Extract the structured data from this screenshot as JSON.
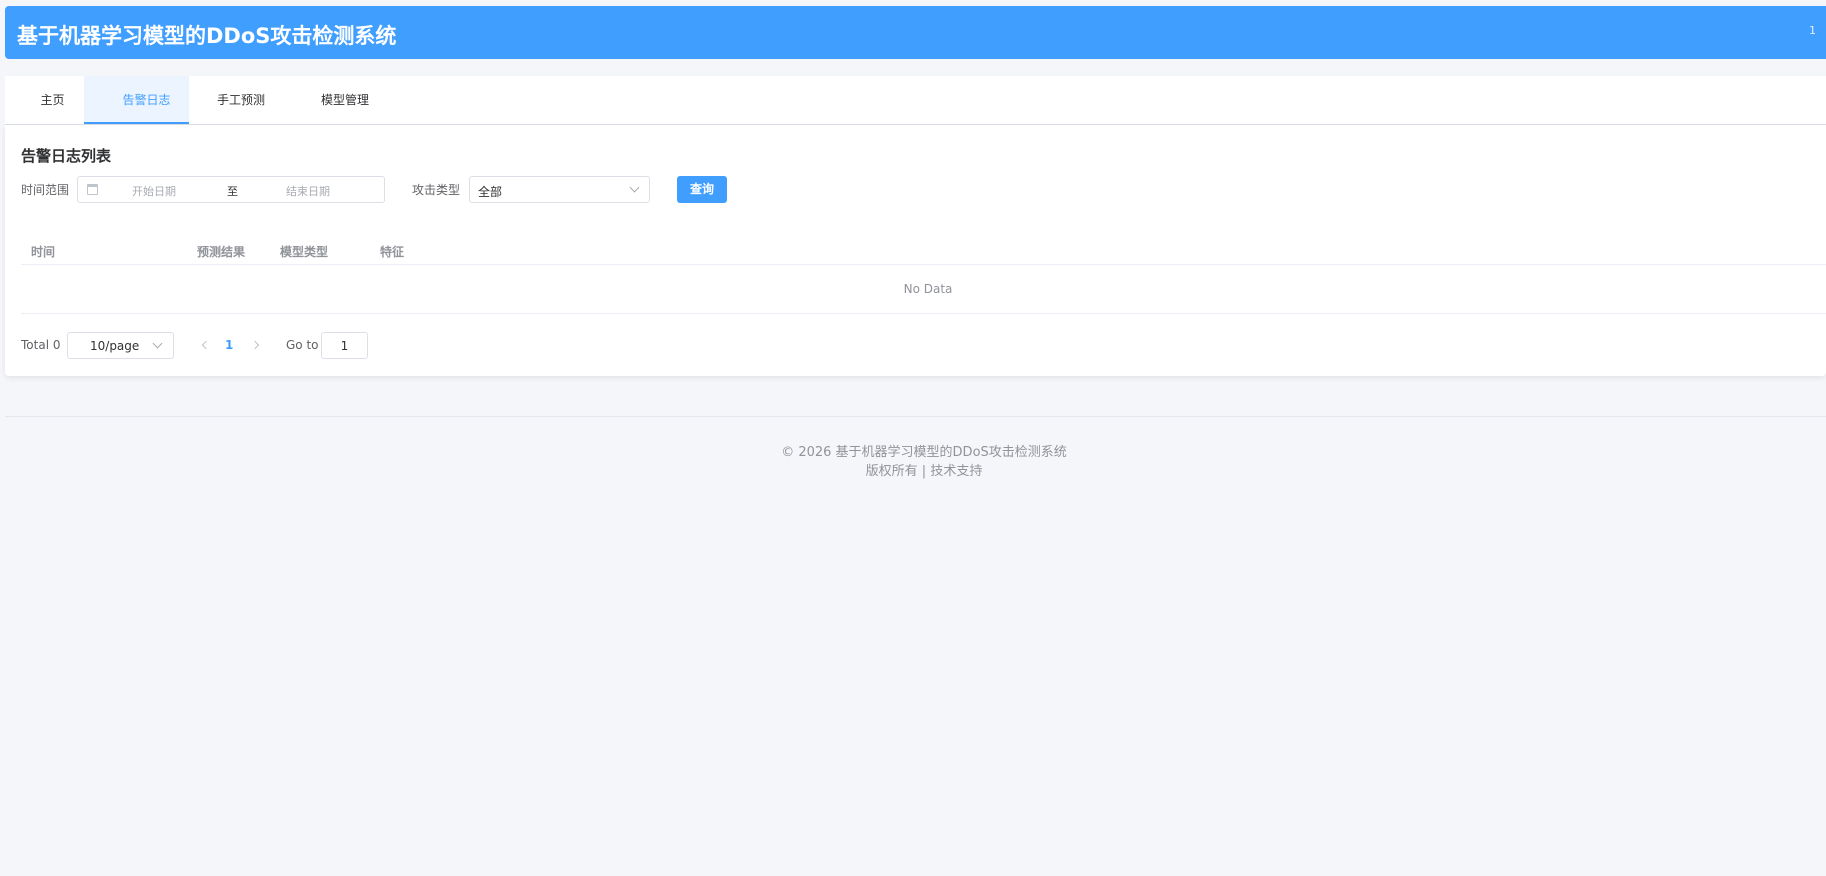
{
  "header": {
    "title": "基于机器学习模型的DDoS攻击检测系统",
    "user": "1"
  },
  "tabs": [
    {
      "label": "主页",
      "active": false
    },
    {
      "label": "告警日志",
      "active": true
    },
    {
      "label": "手工预测",
      "active": false
    },
    {
      "label": "模型管理",
      "active": false
    }
  ],
  "panel": {
    "title": "告警日志列表",
    "filters": {
      "time_label": "时间范围",
      "start_placeholder": "开始日期",
      "range_separator": "至",
      "end_placeholder": "结束日期",
      "type_label": "攻击类型",
      "type_value": "全部",
      "query_button": "查询"
    },
    "table": {
      "columns": [
        "时间",
        "预测结果",
        "模型类型",
        "特征"
      ],
      "empty_text": "No Data"
    },
    "pagination": {
      "total": "Total 0",
      "page_size": "10/page",
      "current_page": "1",
      "goto_label": "Go to",
      "goto_value": "1"
    }
  },
  "footer": {
    "line1": "© 2026 基于机器学习模型的DDoS攻击检测系统",
    "line2": "版权所有 | 技术支持"
  },
  "colors": {
    "primary": "#409eff",
    "background": "#f5f6fa"
  }
}
